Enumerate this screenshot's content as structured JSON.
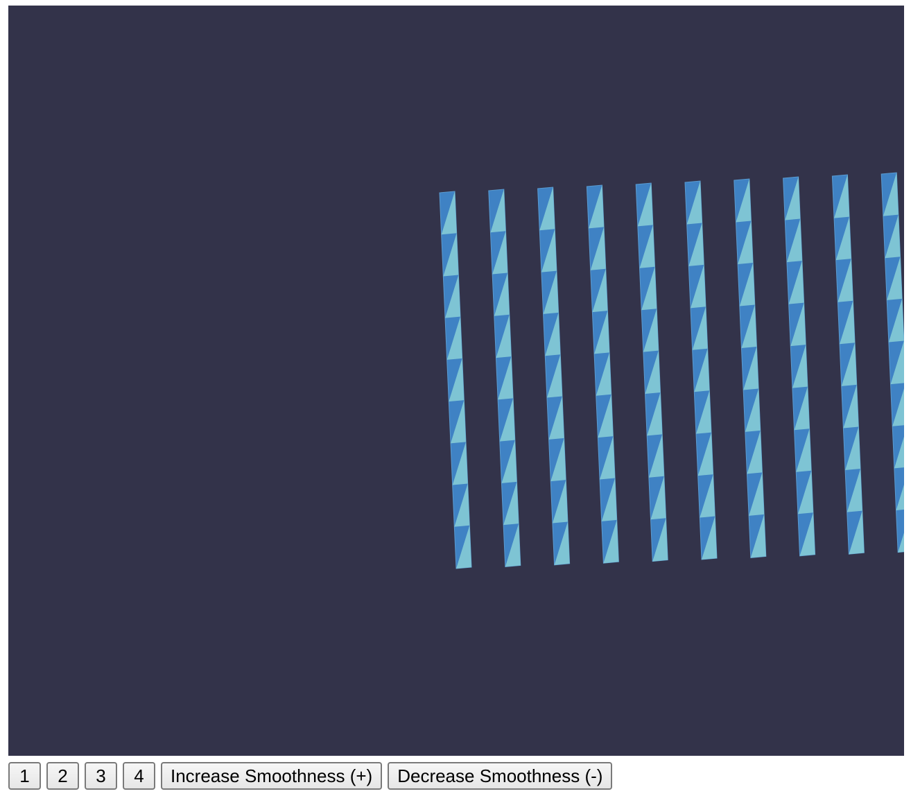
{
  "viewport": {
    "background": "#33334a",
    "colors": {
      "dark_face": "#3f82c4",
      "light_face": "#7ec4d4",
      "edge": "#5a9bd0"
    },
    "strip_count": 10
  },
  "toolbar": {
    "buttons": [
      {
        "label": "1",
        "name": "view-1-button"
      },
      {
        "label": "2",
        "name": "view-2-button"
      },
      {
        "label": "3",
        "name": "view-3-button"
      },
      {
        "label": "4",
        "name": "view-4-button"
      },
      {
        "label": "Increase Smoothness (+)",
        "name": "increase-smoothness-button"
      },
      {
        "label": "Decrease Smoothness (-)",
        "name": "decrease-smoothness-button"
      }
    ]
  }
}
